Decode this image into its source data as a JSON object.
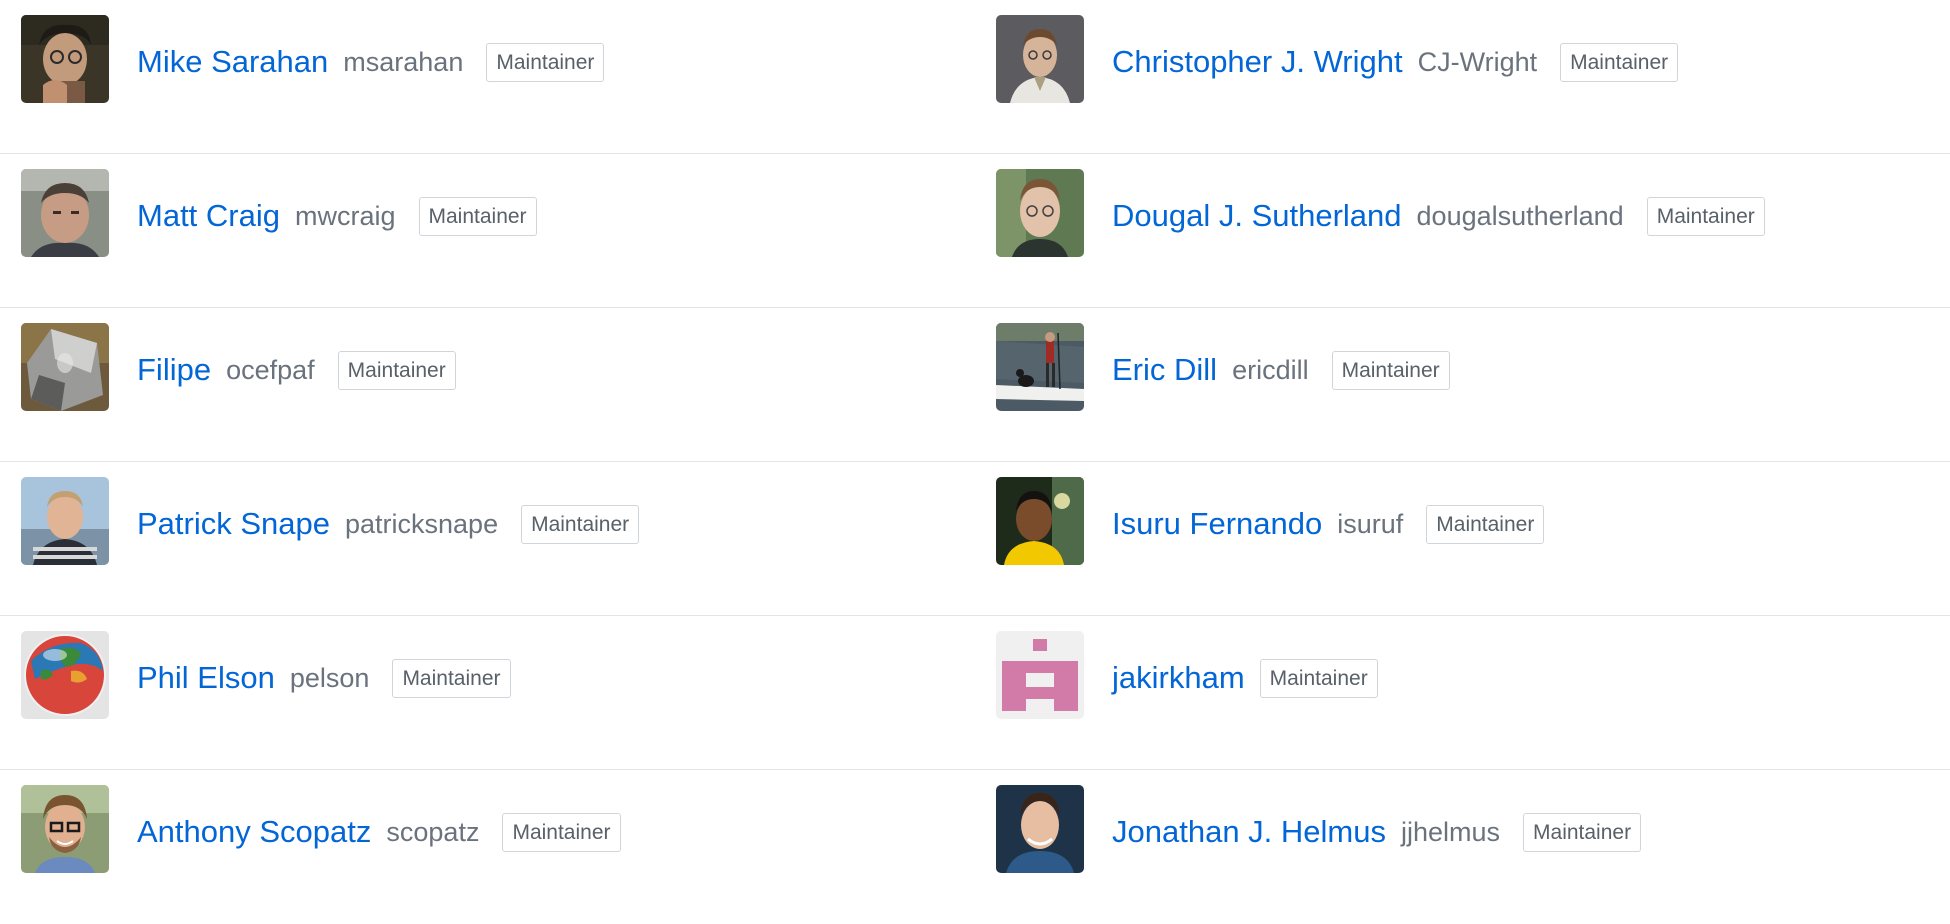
{
  "members": [
    {
      "name": "Mike Sarahan",
      "login": "msarahan",
      "role": "Maintainer",
      "avatar": "portrait-curly-hair-glasses"
    },
    {
      "name": "Christopher J. Wright",
      "login": "CJ-Wright",
      "role": "Maintainer",
      "avatar": "portrait-gray-background"
    },
    {
      "name": "Matt Craig",
      "login": "mwcraig",
      "role": "Maintainer",
      "avatar": "portrait-outdoor-selfie"
    },
    {
      "name": "Dougal J. Sutherland",
      "login": "dougalsutherland",
      "role": "Maintainer",
      "avatar": "portrait-glasses-green"
    },
    {
      "name": "Filipe",
      "login": "ocefpaf",
      "role": "Maintainer",
      "avatar": "metal-bell"
    },
    {
      "name": "Eric Dill",
      "login": "ericdill",
      "role": "Maintainer",
      "avatar": "paddleboard-with-dog"
    },
    {
      "name": "Patrick Snape",
      "login": "patricksnape",
      "role": "Maintainer",
      "avatar": "portrait-striped-shirt"
    },
    {
      "name": "Isuru Fernando",
      "login": "isuruf",
      "role": "Maintainer",
      "avatar": "portrait-yellow-shirt"
    },
    {
      "name": "Phil Elson",
      "login": "pelson",
      "role": "Maintainer",
      "avatar": "globe"
    },
    {
      "name": "jakirkham",
      "login": "",
      "role": "Maintainer",
      "avatar": "pink-identicon"
    },
    {
      "name": "Anthony Scopatz",
      "login": "scopatz",
      "role": "Maintainer",
      "avatar": "portrait-beard-glasses"
    },
    {
      "name": "Jonathan J. Helmus",
      "login": "jjhelmus",
      "role": "Maintainer",
      "avatar": "portrait-dark-background"
    }
  ],
  "colors": {
    "name_link": "#0366d6",
    "login_text": "#6a737d",
    "badge_text": "#586069",
    "badge_border": "#d1d5da",
    "row_divider": "#e2e4e8",
    "identicon_pink": "#d37ba8"
  }
}
